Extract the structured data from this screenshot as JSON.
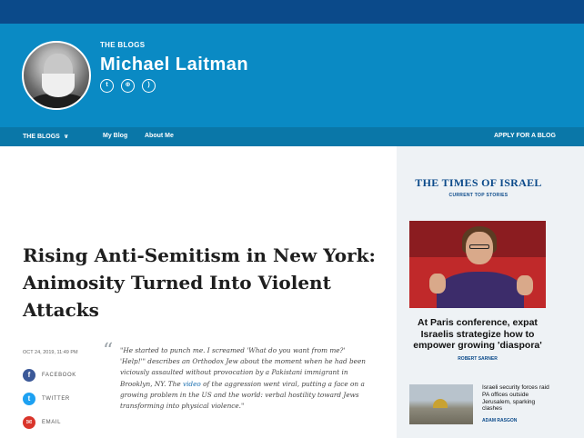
{
  "header": {
    "section_label": "THE BLOGS",
    "author_name": "Michael Laitman",
    "social_icons": [
      "twitter-icon",
      "website-icon",
      "rss-icon"
    ]
  },
  "nav": {
    "blogs_label": "THE BLOGS",
    "my_blog": "My Blog",
    "about_me": "About Me",
    "apply": "APPLY FOR A BLOG"
  },
  "article": {
    "title": "Rising Anti-Semitism in New York: Animosity Turned Into Violent Attacks",
    "date": "OCT 24, 2019, 11:49 PM",
    "share": {
      "facebook": "FACEBOOK",
      "twitter": "TWITTER",
      "email": "EMAIL"
    },
    "quote_before_link": "\"He started to punch me. I screamed 'What do you want from me?' 'Help!'\" describes an Orthodox Jew about the moment when he had been viciously assaulted without provocation by a Pakistani immigrant in Brooklyn, NY. The ",
    "quote_link": "video",
    "quote_after_link": " of the aggression went viral, putting a face on a growing problem in the US and the world: verbal hostility toward Jews transforming into physical violence.\""
  },
  "sidebar": {
    "logo": "THE TIMES OF ISRAEL",
    "subtitle": "CURRENT TOP STORIES",
    "top_story": {
      "title": "At Paris conference, expat Israelis strategize how to empower growing 'diaspora'",
      "byline": "ROBERT SARNER"
    },
    "second_story": {
      "title": "Israeli security forces raid PA offices outside Jerusalem, sparking clashes",
      "byline": "ADAM RASGON"
    }
  },
  "colors": {
    "top_bar": "#0b4a8a",
    "hero": "#0a8ac4",
    "nav": "#0a77a8",
    "facebook": "#3b5998",
    "twitter": "#1da1f2",
    "email": "#d9352b"
  }
}
